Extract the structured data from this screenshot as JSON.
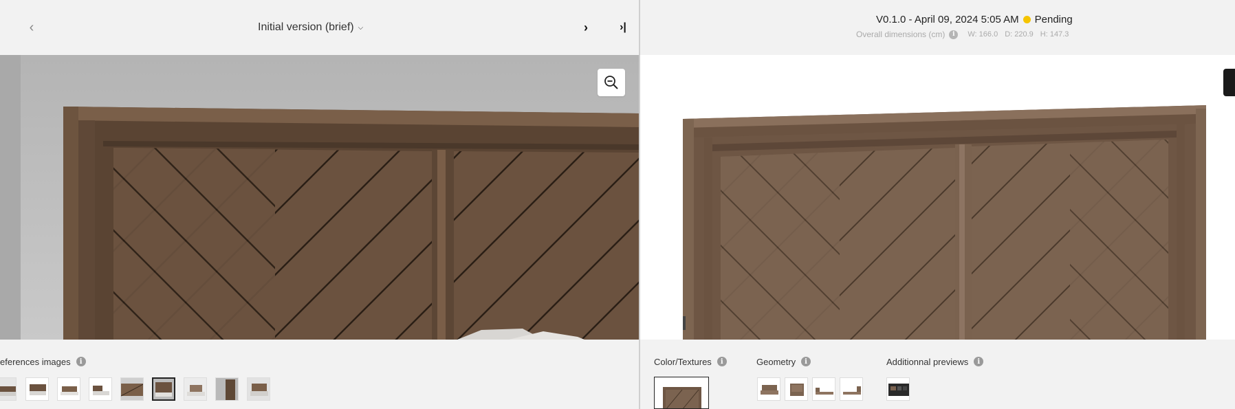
{
  "left_panel": {
    "nav": {
      "prev_icon": "chevron-left-icon",
      "next_icon": "chevron-right-icon",
      "last_icon": "skip-to-last-icon",
      "prev_glyph": "‹",
      "next_glyph": "›",
      "last_glyph": "›|"
    },
    "version_select": {
      "label": "Initial version (brief)",
      "caret": "⌄"
    },
    "zoom_icon": "zoom-out-icon",
    "references": {
      "label": "eferences images",
      "info_glyph": "i",
      "thumb_count": 9,
      "selected_index": 5
    }
  },
  "right_panel": {
    "version_line": {
      "text": "V0.1.0 - April 09, 2024 5:05 AM",
      "status_label": "Pending",
      "status_color": "#f5c400"
    },
    "dimensions": {
      "label": "Overall dimensions (cm)",
      "info_glyph": "i",
      "width": "W: 166.0",
      "depth": "D: 220.9",
      "height": "H: 147.3"
    },
    "sections": {
      "color_textures": "Color/Textures",
      "geometry": "Geometry",
      "additional_previews": "Additionnal previews",
      "info_glyph": "i"
    }
  },
  "colors": {
    "background": "#f2f2f2",
    "wood_dark": "#5e4836",
    "wood_mid": "#7a5f48",
    "wood_light": "#8e7460",
    "status_pending": "#f5c400"
  }
}
